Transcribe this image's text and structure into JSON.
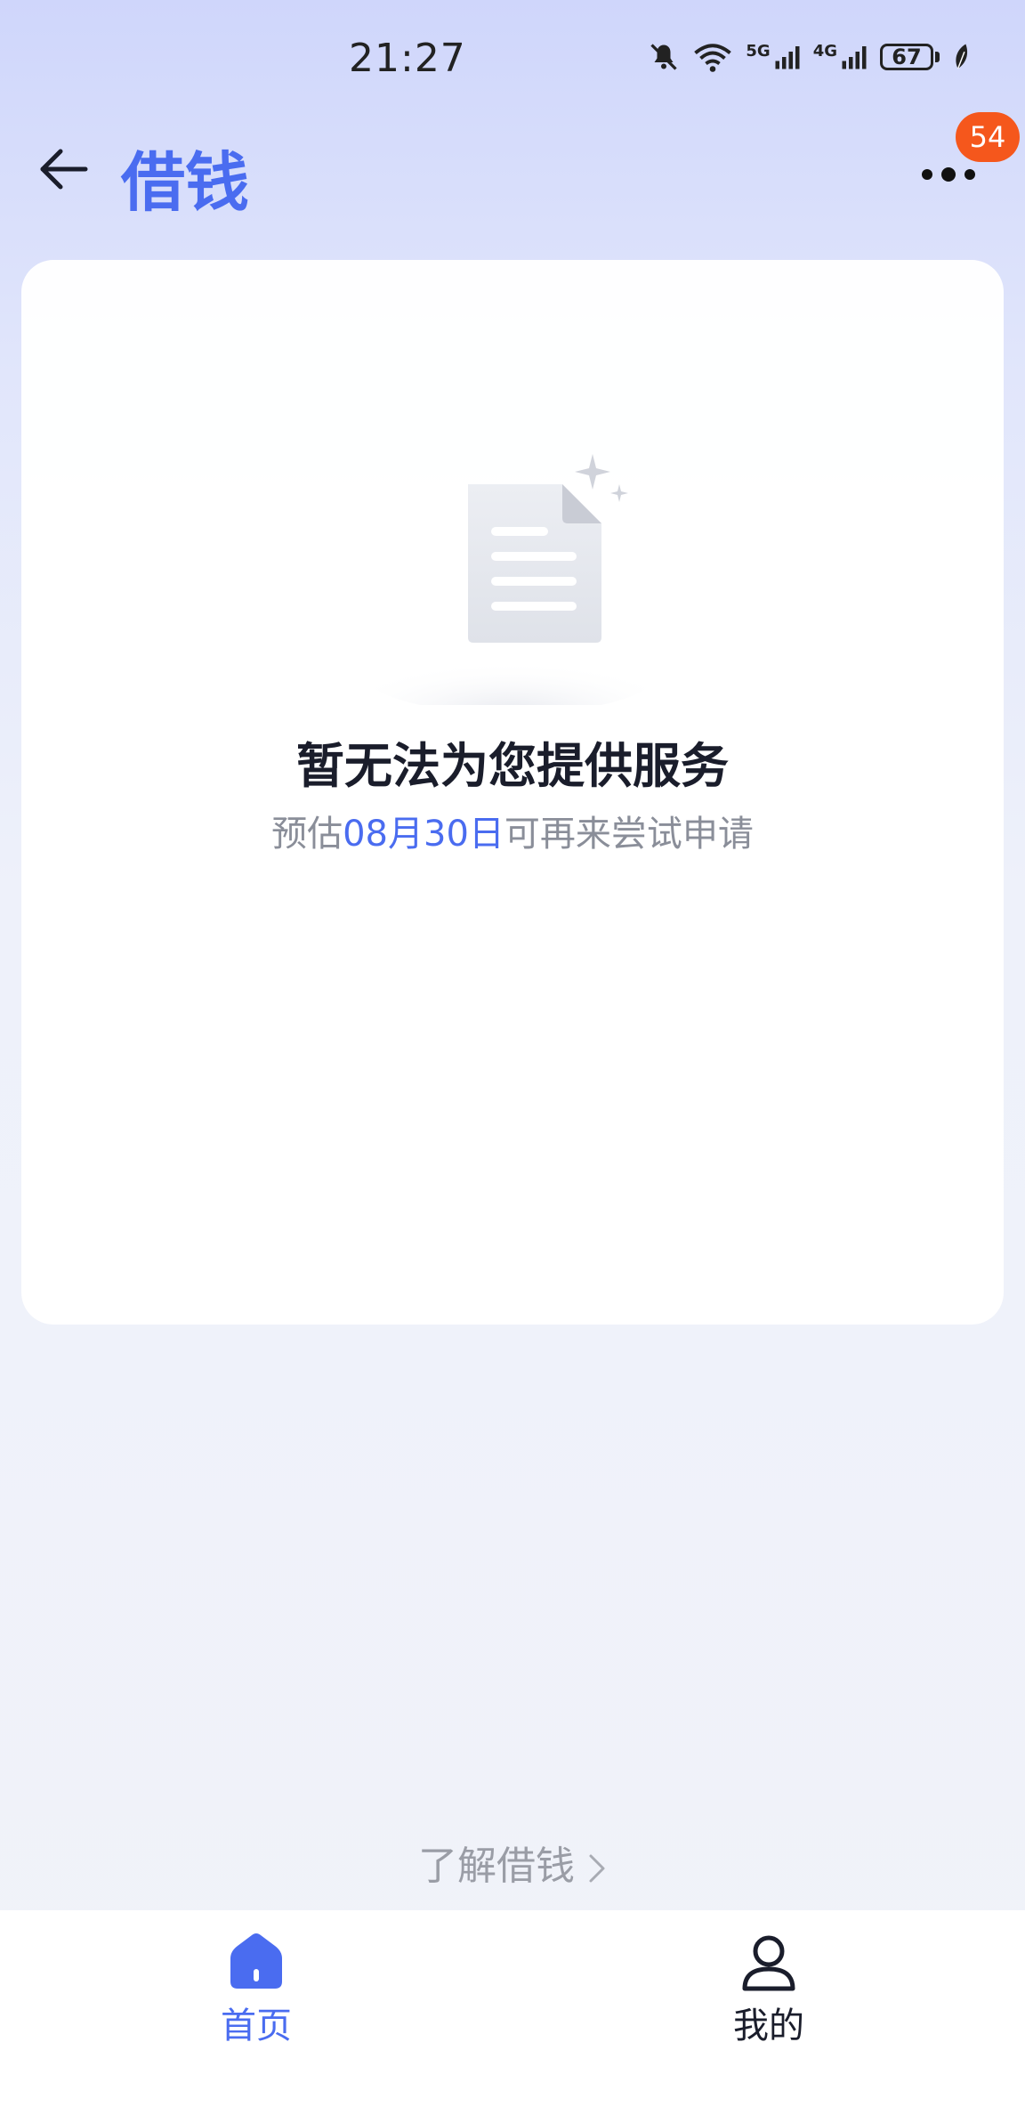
{
  "status_bar": {
    "time": "21:27",
    "network_1": "5G",
    "network_2": "4G",
    "battery": "67"
  },
  "header": {
    "title": "借钱",
    "more_badge": "54"
  },
  "empty_state": {
    "title": "暂无法为您提供服务",
    "subtitle_prefix": "预估",
    "subtitle_date": "08月30日",
    "subtitle_suffix": "可再来尝试申请"
  },
  "learn_more": {
    "label": "了解借钱"
  },
  "tab_bar": {
    "tabs": [
      {
        "label": "首页",
        "icon": "home-icon",
        "active": true
      },
      {
        "label": "我的",
        "icon": "user-icon",
        "active": false
      }
    ]
  },
  "colors": {
    "accent": "#4a6cf0",
    "badge": "#f5571c",
    "title_text": "#1a1d2b",
    "secondary_text": "#8a8e99"
  }
}
